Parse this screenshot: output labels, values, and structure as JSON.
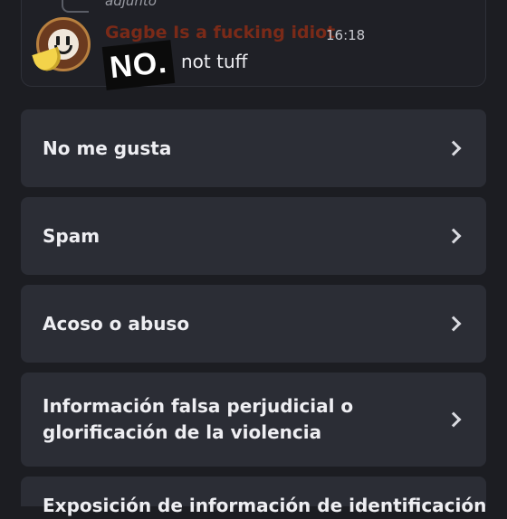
{
  "reported_message": {
    "reply_preview": "adjunto",
    "username": "Gagbe Is a fucking idiot",
    "timestamp": "16:18",
    "text": "not tuff",
    "sticker_text": "NO.",
    "username_color": "#7a2a18"
  },
  "report_options": [
    {
      "label": "No me gusta",
      "icon": "chevron-right-icon"
    },
    {
      "label": "Spam",
      "icon": "chevron-right-icon"
    },
    {
      "label": "Acoso o abuso",
      "icon": "chevron-right-icon"
    },
    {
      "label": "Información falsa perjudicial o glorificación de la violencia",
      "icon": "chevron-right-icon"
    },
    {
      "label": "Exposición de información de identificación",
      "icon": "chevron-right-icon"
    }
  ]
}
